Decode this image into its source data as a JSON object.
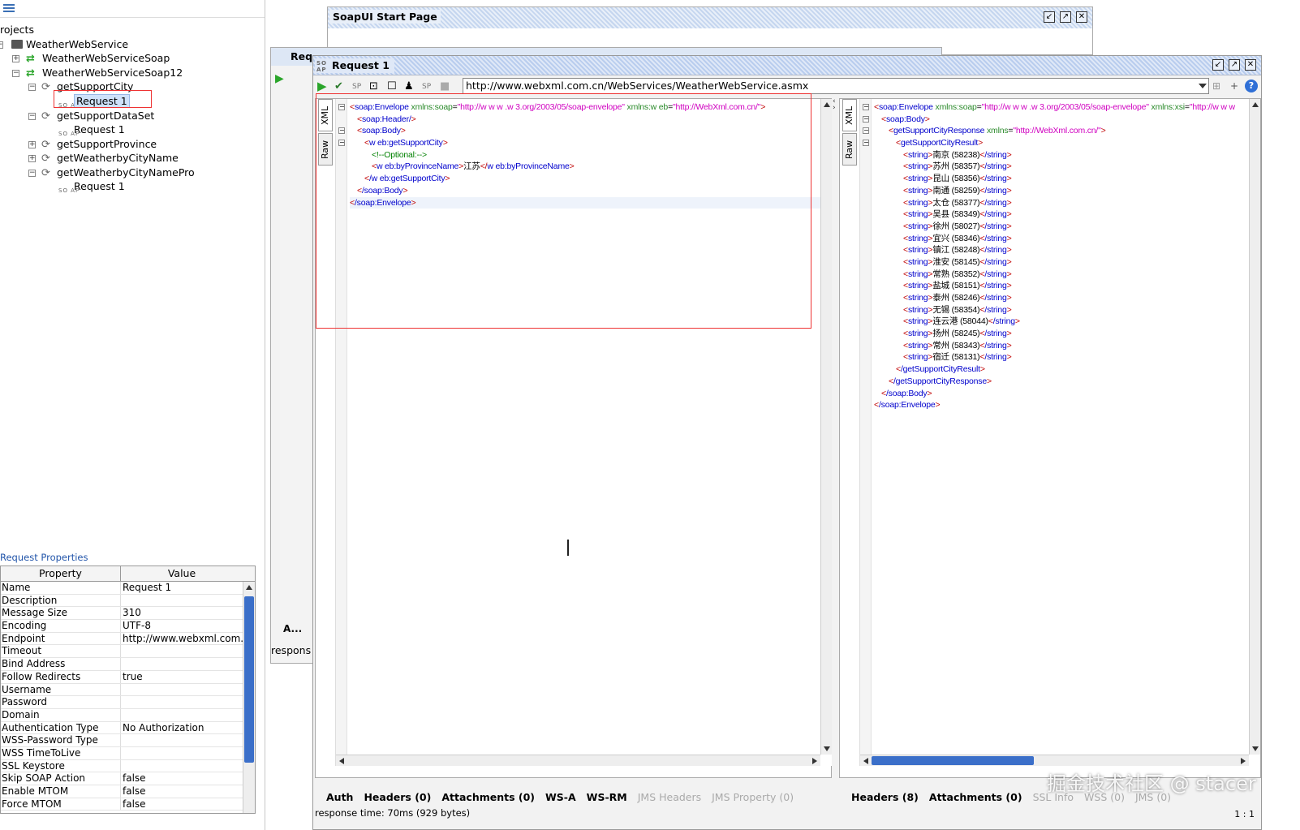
{
  "navigator": {
    "root_label": "rojects",
    "tree": [
      {
        "label": "WeatherWebService"
      },
      {
        "label": "WeatherWebServiceSoap"
      },
      {
        "label": "WeatherWebServiceSoap12"
      },
      {
        "label": "getSupportCity"
      },
      {
        "label": "Request 1"
      },
      {
        "label": "getSupportDataSet"
      },
      {
        "label": "Request 1"
      },
      {
        "label": "getSupportProvince"
      },
      {
        "label": "getWeatherbyCityName"
      },
      {
        "label": "getWeatherbyCityNamePro"
      },
      {
        "label": "Request 1"
      }
    ]
  },
  "properties": {
    "title": "Request Properties",
    "col_property": "Property",
    "col_value": "Value",
    "rows": [
      {
        "name": "Name",
        "value": "Request 1"
      },
      {
        "name": "Description",
        "value": ""
      },
      {
        "name": "Message Size",
        "value": "310"
      },
      {
        "name": "Encoding",
        "value": "UTF-8"
      },
      {
        "name": "Endpoint",
        "value": "http://www.webxml.com...."
      },
      {
        "name": "Timeout",
        "value": ""
      },
      {
        "name": "Bind Address",
        "value": ""
      },
      {
        "name": "Follow Redirects",
        "value": "true"
      },
      {
        "name": "Username",
        "value": ""
      },
      {
        "name": "Password",
        "value": ""
      },
      {
        "name": "Domain",
        "value": ""
      },
      {
        "name": "Authentication Type",
        "value": "No Authorization"
      },
      {
        "name": "WSS-Password Type",
        "value": ""
      },
      {
        "name": "WSS TimeToLive",
        "value": ""
      },
      {
        "name": "SSL Keystore",
        "value": ""
      },
      {
        "name": "Skip SOAP Action",
        "value": "false"
      },
      {
        "name": "Enable MTOM",
        "value": "false"
      },
      {
        "name": "Force MTOM",
        "value": "false"
      }
    ]
  },
  "start_page": {
    "title": "SoapUI Start Page"
  },
  "bg_request": {
    "title": "Req",
    "tab_a": "A...",
    "resp": "respons"
  },
  "request": {
    "title": "Request 1",
    "endpoint": "http://www.webxml.com.cn/WebServices/WeatherWebService.asmx",
    "request_tabs": {
      "xml": "XML",
      "raw": "Raw"
    },
    "response_tabs": {
      "xml": "XML",
      "raw": "Raw"
    },
    "req_xml": {
      "envelope_open": "soap:Envelope",
      "xmlns_soap_attr": "xmlns:soap",
      "xmlns_soap_val": "\"http://w w w .w 3.org/2003/05/soap-envelope\"",
      "xmlns_web_attr": "xmlns:w eb",
      "xmlns_web_val": "\"http://WebXml.com.cn/\"",
      "header": "soap:Header/",
      "body": "soap:Body",
      "method": "w eb:getSupportCity",
      "comment": "<!--Optional:-->",
      "param": "w eb:byProvinceName",
      "param_value": "江苏",
      "method_close": "/w eb:getSupportCity",
      "body_close": "/soap:Body",
      "envelope_close": "/soap:Envelope"
    },
    "resp_xml": {
      "envelope_open": "soap:Envelope",
      "xmlns_soap_attr": "xmlns:soap",
      "xmlns_soap_val": "\"http://w w w .w 3.org/2003/05/soap-envelope\"",
      "xmlns_xsi_attr": "xmlns:xsi",
      "xmlns_xsi_val": "\"http://w w w",
      "body": "soap:Body",
      "response": "getSupportCityResponse",
      "xmlns_attr": "xmlns",
      "xmlns_val": "\"http://WebXml.com.cn/\"",
      "result": "getSupportCityResult",
      "string_tag": "string",
      "string_close": "/string",
      "cities": [
        "南京 (58238)",
        "苏州 (58357)",
        "昆山 (58356)",
        "南通 (58259)",
        "太仓 (58377)",
        "吴县 (58349)",
        "徐州 (58027)",
        "宜兴 (58346)",
        "镇江 (58248)",
        "淮安 (58145)",
        "常熟 (58352)",
        "盐城 (58151)",
        "泰州 (58246)",
        "无锡 (58354)",
        "连云港 (58044)",
        "扬州 (58245)",
        "常州 (58343)",
        "宿迁 (58131)"
      ],
      "result_close": "/getSupportCityResult",
      "response_close": "/getSupportCityResponse",
      "body_close": "/soap:Body",
      "envelope_close": "/soap:Envelope"
    },
    "request_bottom_tabs": [
      {
        "label": "Auth",
        "enabled": true
      },
      {
        "label": "Headers (0)",
        "enabled": true
      },
      {
        "label": "Attachments (0)",
        "enabled": true
      },
      {
        "label": "WS-A",
        "enabled": true
      },
      {
        "label": "WS-RM",
        "enabled": true
      },
      {
        "label": "JMS Headers",
        "enabled": false
      },
      {
        "label": "JMS Property (0)",
        "enabled": false
      }
    ],
    "response_bottom_tabs": [
      {
        "label": "Headers (8)",
        "enabled": true
      },
      {
        "label": "Attachments (0)",
        "enabled": true
      },
      {
        "label": "SSL Info",
        "enabled": false
      },
      {
        "label": "WSS (0)",
        "enabled": false
      },
      {
        "label": "JMS (0)",
        "enabled": false
      }
    ],
    "status": "response time: 70ms (929 bytes)",
    "cursor_pos": "1 : 1"
  },
  "watermark": "掘金技术社区 @ stacer",
  "colors": {
    "highlight": "#e33333",
    "tag": "#0000cc",
    "bracket": "#c00000",
    "attr": "#2a8a2a",
    "value": "#d000c0",
    "accent": "#3b6fc9"
  }
}
